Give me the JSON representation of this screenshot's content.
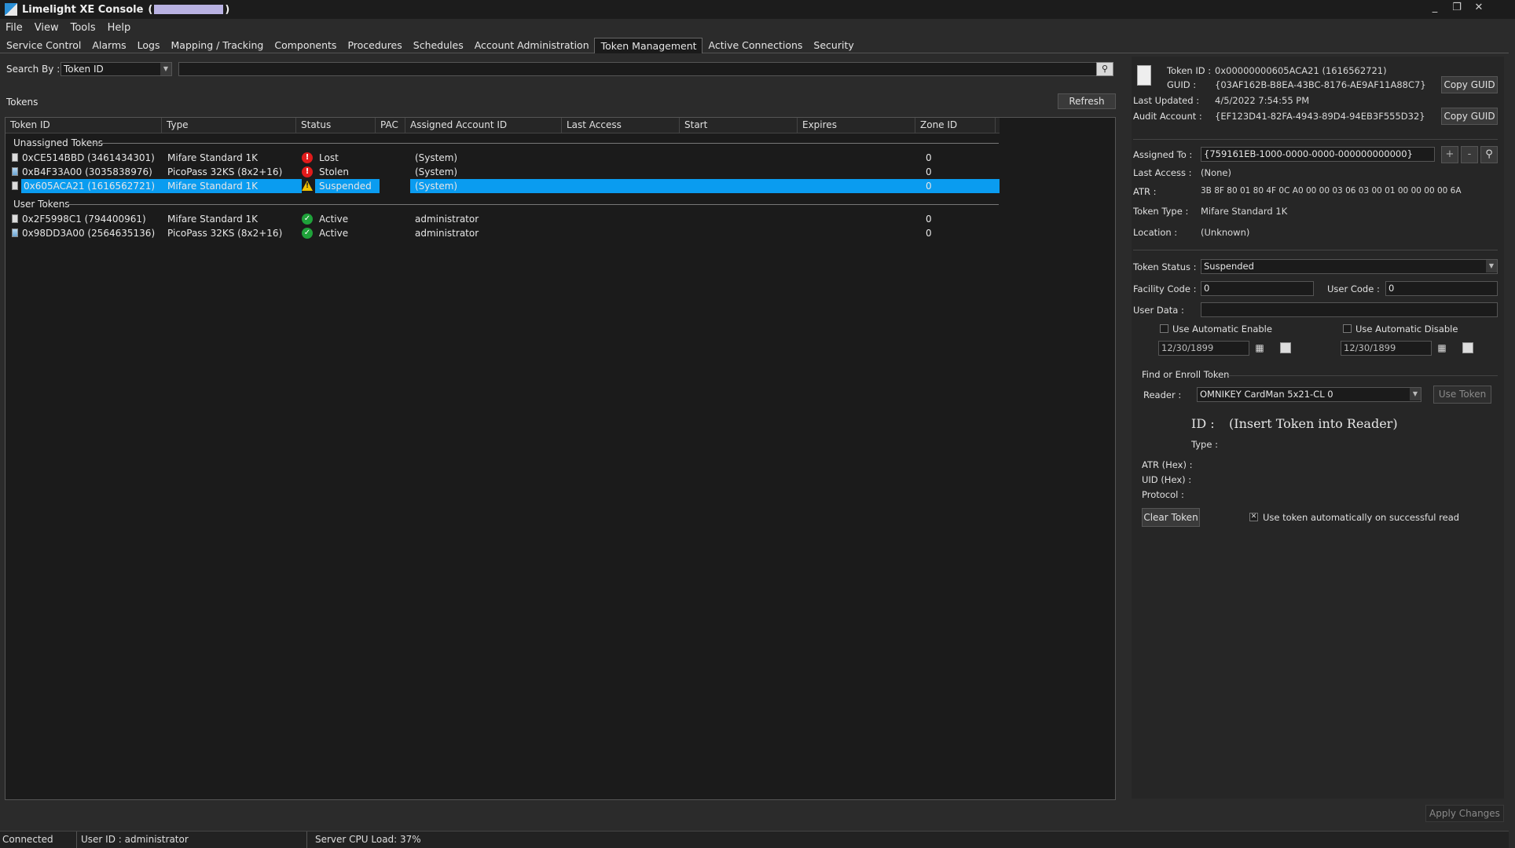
{
  "window": {
    "title": "Limelight XE Console",
    "title_paren_open": "(",
    "title_paren_close": ")",
    "controls": [
      "_",
      "❐",
      "✕"
    ]
  },
  "menu": [
    "File",
    "View",
    "Tools",
    "Help"
  ],
  "tabs": [
    {
      "label": "Service Control"
    },
    {
      "label": "Alarms"
    },
    {
      "label": "Logs"
    },
    {
      "label": "Mapping / Tracking"
    },
    {
      "label": "Components"
    },
    {
      "label": "Procedures"
    },
    {
      "label": "Schedules"
    },
    {
      "label": "Account Administration"
    },
    {
      "label": "Token Management",
      "active": true
    },
    {
      "label": "Active Connections"
    },
    {
      "label": "Security"
    }
  ],
  "search": {
    "label": "Search By :",
    "field": "Token ID",
    "value": ""
  },
  "tokens": {
    "label": "Tokens",
    "refresh_label": "Refresh",
    "columns": [
      "Token ID",
      "Type",
      "Status",
      "PAC",
      "Assigned Account ID",
      "Last Access",
      "Start",
      "Expires",
      "Zone ID"
    ],
    "groups": {
      "unassigned": "Unassigned Tokens",
      "user": "User Tokens"
    },
    "unassigned_rows": [
      {
        "id": "0xCE514BBD (3461434301)",
        "type": "Mifare Standard 1K",
        "status": "Lost",
        "status_kind": "err",
        "account": "(System)",
        "zone": "0",
        "card": "plain"
      },
      {
        "id": "0xB4F33A00 (3035838976)",
        "type": "PicoPass 32KS (8x2+16)",
        "status": "Stolen",
        "status_kind": "err",
        "account": "(System)",
        "zone": "0",
        "card": "pic"
      },
      {
        "id": "0x605ACA21 (1616562721)",
        "type": "Mifare Standard 1K",
        "status": "Suspended",
        "status_kind": "warn",
        "account": "(System)",
        "zone": "0",
        "card": "plain",
        "selected": true
      }
    ],
    "user_rows": [
      {
        "id": "0x2F5998C1 (794400961)",
        "type": "Mifare Standard 1K",
        "status": "Active",
        "status_kind": "ok",
        "account": "administrator",
        "zone": "0",
        "card": "plain"
      },
      {
        "id": "0x98DD3A00 (2564635136)",
        "type": "PicoPass 32KS (8x2+16)",
        "status": "Active",
        "status_kind": "ok",
        "account": "administrator",
        "zone": "0",
        "card": "pic"
      }
    ]
  },
  "detail": {
    "token_id_label": "Token ID :",
    "token_id": "0x00000000605ACA21 (1616562721)",
    "guid_label": "GUID :",
    "guid": "{03AF162B-B8EA-43BC-8176-AE9AF11A88C7}",
    "last_updated_label": "Last Updated :",
    "last_updated": "4/5/2022 7:54:55 PM",
    "audit_account_label": "Audit Account :",
    "audit_account": "{EF123D41-82FA-4943-89D4-94EB3F555D32}",
    "copy_guid_label": "Copy GUID",
    "assigned_to_label": "Assigned To :",
    "assigned_to": "{759161EB-1000-0000-0000-000000000000}",
    "add_label": "+",
    "remove_label": "-",
    "last_access_label": "Last Access :",
    "last_access": "(None)",
    "atr_label": "ATR :",
    "atr": "3B 8F 80 01 80 4F 0C A0 00 00 03 06 03 00 01 00 00 00 00 6A",
    "token_type_label": "Token Type :",
    "token_type": "Mifare Standard 1K",
    "location_label": "Location :",
    "location": "(Unknown)",
    "token_status_label": "Token Status :",
    "token_status": "Suspended",
    "facility_code_label": "Facility Code :",
    "facility_code": "0",
    "user_code_label": "User Code :",
    "user_code": "0",
    "user_data_label": "User Data :",
    "user_data": "",
    "auto_enable_label": "Use Automatic Enable",
    "auto_disable_label": "Use Automatic Disable",
    "enable_date": "12/30/1899",
    "disable_date": "12/30/1899"
  },
  "enroll": {
    "section_label": "Find or Enroll Token",
    "reader_label": "Reader :",
    "reader": "OMNIKEY CardMan 5x21-CL 0",
    "use_token_label": "Use Token",
    "id_label": "ID :",
    "id_value": "(Insert Token into Reader)",
    "type_label": "Type :",
    "atr_hex_label": "ATR (Hex) :",
    "uid_hex_label": "UID (Hex) :",
    "protocol_label": "Protocol :",
    "clear_token_label": "Clear Token",
    "auto_use_checked": "✕",
    "auto_use_label": "Use token automatically on successful read"
  },
  "apply_label": "Apply Changes",
  "status_bar": {
    "connection": "Connected",
    "user": "User ID : administrator",
    "cpu": "Server CPU Load: 37%"
  },
  "colors": {
    "selection": "#0a9cf0",
    "error": "#e11b1b",
    "ok": "#1fa23a",
    "warning": "#f2c200"
  },
  "icons": {
    "app": "limelight-logo-icon",
    "search": "magnifier-icon",
    "calendar": "calendar-icon",
    "token": "token-card-icon"
  }
}
